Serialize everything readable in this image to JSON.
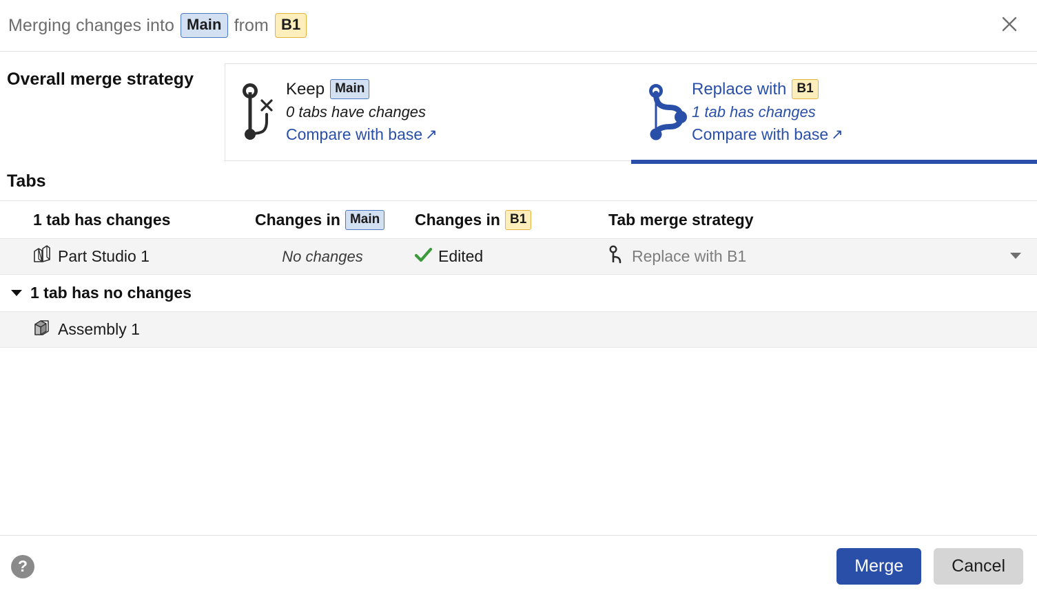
{
  "titlebar": {
    "prefix": "Merging changes into",
    "target_branch": "Main",
    "middle": "from",
    "source_branch": "B1",
    "close_icon": "close-icon"
  },
  "sections": {
    "overall_heading": "Overall merge strategy",
    "tabs_heading": "Tabs"
  },
  "strategy_cards": [
    {
      "action": "Keep",
      "branch": "Main",
      "summary": "0 tabs have changes",
      "link": "Compare with base",
      "link_arrow": "↗",
      "selected": false,
      "icon": "branch-discard-icon"
    },
    {
      "action": "Replace with",
      "branch": "B1",
      "summary": "1 tab has changes",
      "link": "Compare with base",
      "link_arrow": "↗",
      "selected": true,
      "icon": "branch-merge-icon"
    }
  ],
  "table": {
    "headers": {
      "col_tabs": "1 tab has changes",
      "col_changes_main_prefix": "Changes in",
      "col_changes_main_badge": "Main",
      "col_changes_b1_prefix": "Changes in",
      "col_changes_b1_badge": "B1",
      "col_strategy": "Tab merge strategy"
    },
    "rows": [
      {
        "name": "Part Studio 1",
        "icon": "part-studio-icon",
        "changes_main": "No changes",
        "changes_b1": "Edited",
        "changes_b1_icon": "check-icon",
        "strategy": "Replace with B1",
        "strategy_icon": "branch-small-icon",
        "chevron": "chevron-down-icon"
      }
    ],
    "no_changes_group": {
      "title": "1 tab has no changes",
      "caret": "caret-down-icon",
      "rows": [
        {
          "name": "Assembly 1",
          "icon": "assembly-icon"
        }
      ]
    }
  },
  "footer": {
    "help_glyph": "?",
    "merge_label": "Merge",
    "cancel_label": "Cancel"
  },
  "colors": {
    "accent_blue": "#2a4fa8",
    "badge_main_bg": "#d2e0f2",
    "badge_main_border": "#4a79c4",
    "badge_b1_bg": "#fdeebc",
    "badge_b1_border": "#e3b33f",
    "check_green": "#3c9a3c",
    "row_bg": "#f4f4f4"
  }
}
